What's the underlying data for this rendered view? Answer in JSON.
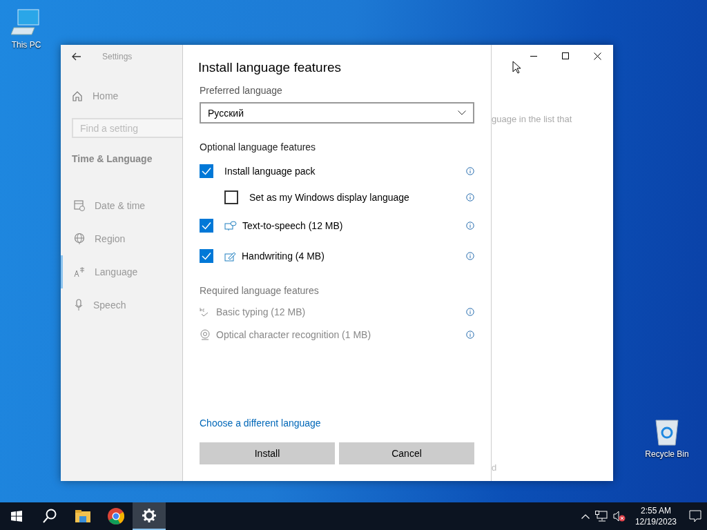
{
  "desktop_icons": [
    {
      "label": "This PC",
      "kind": "computer"
    },
    {
      "label": "Recycle Bin",
      "kind": "bin"
    }
  ],
  "settings": {
    "title": "Settings",
    "home": {
      "label": "Home"
    },
    "search": {
      "placeholder": "Find a setting"
    },
    "section": "Time & Language",
    "items": [
      {
        "label": "Date & time",
        "kind": "calendar",
        "selected": false
      },
      {
        "label": "Region",
        "kind": "globe",
        "selected": false
      },
      {
        "label": "Language",
        "kind": "language",
        "selected": true
      },
      {
        "label": "Speech",
        "kind": "mic",
        "selected": false
      }
    ],
    "background_text": [
      "guage in the list that",
      "d"
    ]
  },
  "dialog": {
    "title": "Install language features",
    "preferred_label": "Preferred language",
    "dropdown": {
      "value": "Русский"
    },
    "optional_heading": "Optional language features",
    "optional": [
      {
        "label": "Install language pack",
        "kind": "plain",
        "checked": true,
        "children": [
          {
            "label": "Set as my Windows display language",
            "kind": "plain",
            "checked": false
          }
        ]
      },
      {
        "label": "Text-to-speech (12 MB)",
        "kind": "speech",
        "checked": true
      },
      {
        "label": "Handwriting (4 MB)",
        "kind": "pen",
        "checked": true
      }
    ],
    "required_heading": "Required language features",
    "required": [
      {
        "label": "Basic typing (12 MB)",
        "kind": "typing"
      },
      {
        "label": "Optical character recognition (1 MB)",
        "kind": "ocr"
      }
    ],
    "link": "Choose a different language",
    "buttons": [
      "Install",
      "Cancel"
    ]
  },
  "taskbar": {
    "apps": [
      {
        "kind": "start",
        "selected": false
      },
      {
        "kind": "search",
        "selected": false
      },
      {
        "kind": "folder",
        "selected": false
      },
      {
        "kind": "browser",
        "selected": false
      },
      {
        "kind": "settings",
        "selected": true
      }
    ],
    "time": "2:55 AM",
    "date": "12/19/2023"
  }
}
